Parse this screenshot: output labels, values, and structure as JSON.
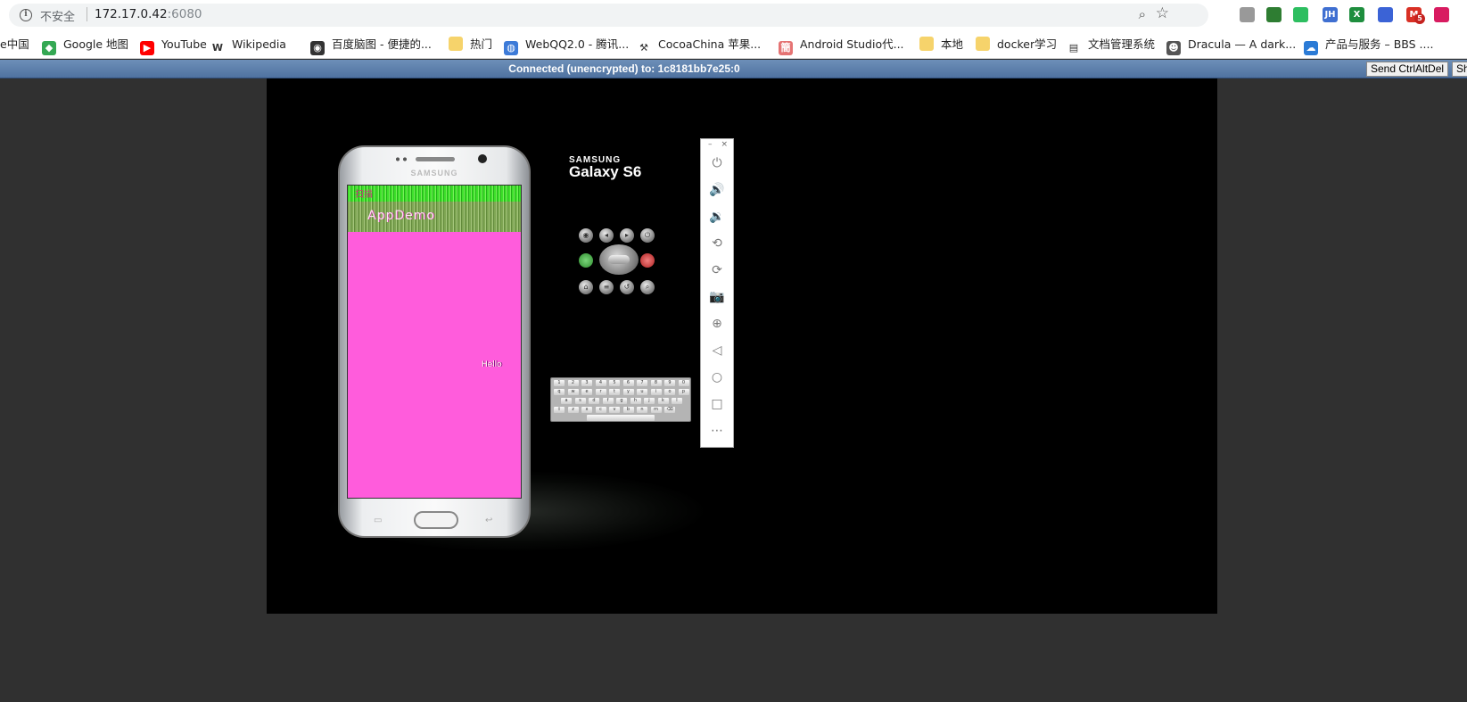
{
  "address_bar": {
    "security_label": "不安全",
    "url_host": "172.17.0.42",
    "url_port": ":6080"
  },
  "extensions": [
    {
      "icon": "v-shield-icon",
      "label": "",
      "color": "#999999"
    },
    {
      "icon": "globe-icon",
      "label": "",
      "color": "#2e7d32"
    },
    {
      "icon": "evernote-icon",
      "label": "",
      "color": "#2dbe60"
    },
    {
      "icon": "jh-icon",
      "label": "JH",
      "color": "#3f6fd1"
    },
    {
      "icon": "excel-icon",
      "label": "X",
      "color": "#1e8e3e"
    },
    {
      "icon": "calendar-icon",
      "label": "",
      "color": "#3b63d6"
    },
    {
      "icon": "gmail-icon",
      "label": "M",
      "color": "#d93025",
      "badge": "5"
    },
    {
      "icon": "bird-icon",
      "label": "",
      "color": "#d81b60"
    }
  ],
  "bookmarks": [
    {
      "label": "e中国",
      "icon": "",
      "color": ""
    },
    {
      "label": "Google 地图",
      "icon": "maps-icon",
      "color": "#34a853"
    },
    {
      "label": "YouTube",
      "icon": "youtube-icon",
      "color": "#ff0000"
    },
    {
      "label": "Wikipedia",
      "icon": "wikipedia-icon",
      "color": "#ffffff"
    },
    {
      "label": "百度脑图 - 便捷的...",
      "icon": "owl-icon",
      "color": "#333333"
    },
    {
      "label": "热门",
      "icon": "folder-icon",
      "color": "#f6d36b"
    },
    {
      "label": "WebQQ2.0 - 腾讯...",
      "icon": "globe-icon",
      "color": "#3d7bd8"
    },
    {
      "label": "CocoaChina 苹果...",
      "icon": "pickaxe-icon",
      "color": "#ffffff"
    },
    {
      "label": "Android Studio代...",
      "icon": "android-icon",
      "color": "#e57373"
    },
    {
      "label": "本地",
      "icon": "folder-icon",
      "color": "#f6d36b"
    },
    {
      "label": "docker学习",
      "icon": "folder-icon",
      "color": "#f6d36b"
    },
    {
      "label": "文档管理系统",
      "icon": "document-icon",
      "color": "#ffffff"
    },
    {
      "label": "Dracula — A dark...",
      "icon": "dracula-icon",
      "color": "#555555"
    },
    {
      "label": "产品与服务 – BBS ....",
      "icon": "cloud-icon",
      "color": "#2b7bd6"
    }
  ],
  "vnc": {
    "status": "Connected (unencrypted) to: 1c8181bb7e25:0",
    "send_ctrl_alt_del": "Send CtrlAltDel",
    "truncated_button": "Sh"
  },
  "emulator": {
    "logo_brand": "SAMSUNG",
    "logo_model": "Galaxy S6",
    "phone_brand": "SAMSUNG",
    "app_status_text": "扫描",
    "app_title": "AppDemo",
    "app_body_text": "Hello"
  },
  "keyboard_rows": [
    [
      "1",
      "2",
      "3",
      "4",
      "5",
      "6",
      "7",
      "8",
      "9",
      "0"
    ],
    [
      "q",
      "w",
      "e",
      "r",
      "t",
      "y",
      "u",
      "i",
      "o",
      "p"
    ],
    [
      "a",
      "s",
      "d",
      "f",
      "g",
      "h",
      "j",
      "k",
      "l"
    ],
    [
      "⇧",
      "z",
      "x",
      "c",
      "v",
      "b",
      "n",
      "m",
      "⌫"
    ]
  ],
  "side_toolbar": [
    {
      "name": "power-icon",
      "glyph": "⏻"
    },
    {
      "name": "volume-up-icon",
      "glyph": "🔊"
    },
    {
      "name": "volume-down-icon",
      "glyph": "🔉"
    },
    {
      "name": "rotate-left-icon",
      "glyph": "⟲"
    },
    {
      "name": "rotate-right-icon",
      "glyph": "⟳"
    },
    {
      "name": "camera-icon",
      "glyph": "📷"
    },
    {
      "name": "zoom-icon",
      "glyph": "⊕"
    },
    {
      "name": "back-icon",
      "glyph": "◁"
    },
    {
      "name": "home-icon",
      "glyph": "○"
    },
    {
      "name": "overview-icon",
      "glyph": "□"
    },
    {
      "name": "more-icon",
      "glyph": "⋯"
    }
  ]
}
